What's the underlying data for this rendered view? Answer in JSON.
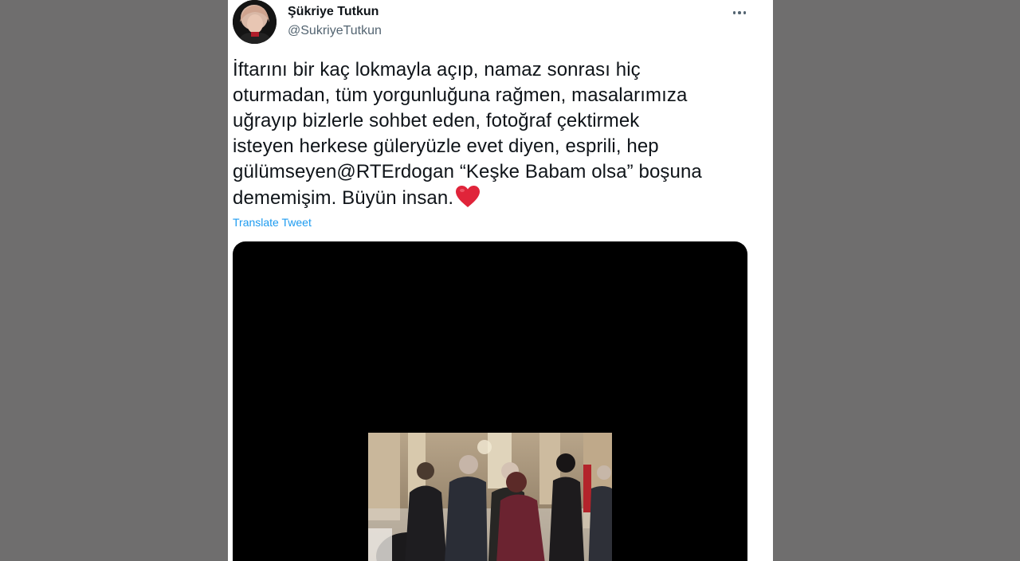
{
  "author": {
    "name": "Şükriye Tutkun",
    "handle": "@SukriyeTutkun"
  },
  "tweet": {
    "lines": [
      "İftarını bir kaç lokmayla açıp, namaz sonrası hiç",
      "oturmadan, tüm yorgunluğuna rağmen, masalarımıza",
      "uğrayıp bizlerle sohbet eden, fotoğraf çektirmek",
      "isteyen herkese güleryüzle evet diyen, esprili, hep",
      "gülümseyen@RTErdogan “Keşke Babam olsa” boşuna",
      "dememişim. Büyün insan."
    ],
    "emoji": "red-heart-icon",
    "translate_label": "Translate Tweet"
  },
  "colors": {
    "background": "#6f6e6e",
    "card": "#ffffff",
    "text": "#0f1419",
    "secondary": "#536471",
    "link": "#1d9bf0",
    "heart": "#e0243a",
    "media": "#000000"
  }
}
